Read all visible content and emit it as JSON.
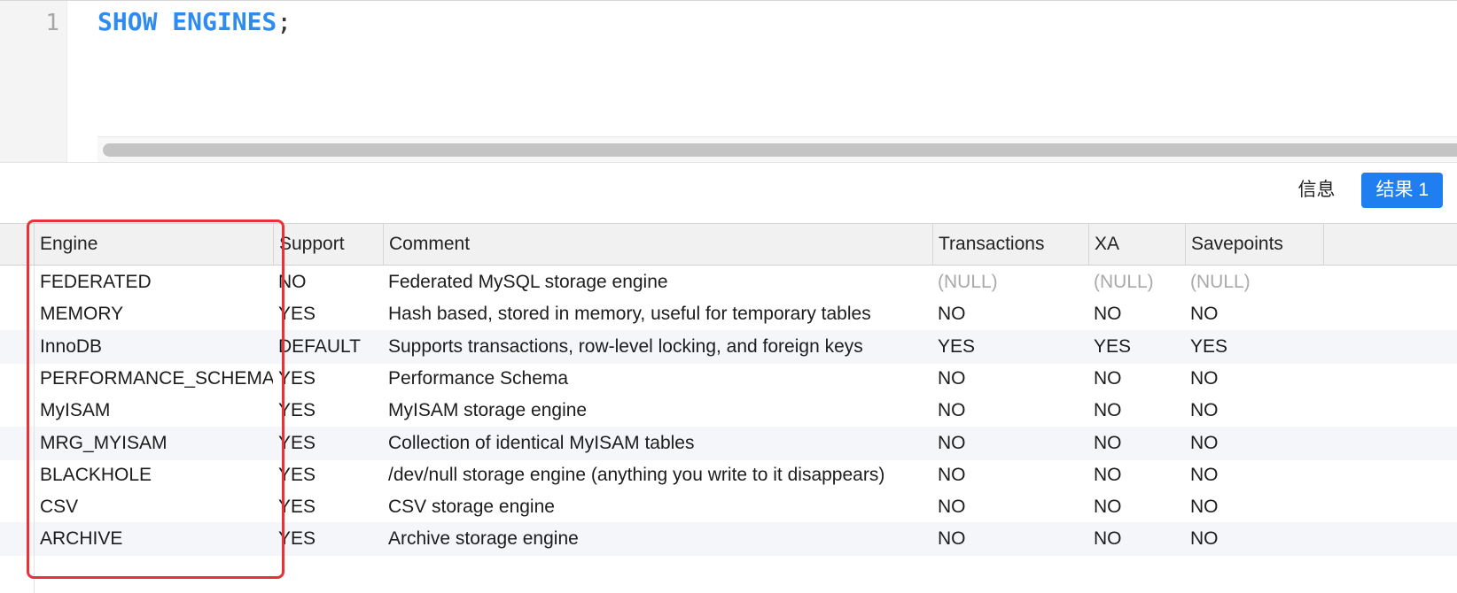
{
  "editor": {
    "line_number": "1",
    "keyword": "SHOW ENGINES",
    "terminator": ";"
  },
  "tabs": {
    "info": "信息",
    "result": "结果 1"
  },
  "table": {
    "columns": [
      "Engine",
      "Support",
      "Comment",
      "Transactions",
      "XA",
      "Savepoints"
    ],
    "rows": [
      [
        "FEDERATED",
        "NO",
        "Federated MySQL storage engine",
        "(NULL)",
        "(NULL)",
        "(NULL)"
      ],
      [
        "MEMORY",
        "YES",
        "Hash based, stored in memory, useful for temporary tables",
        "NO",
        "NO",
        "NO"
      ],
      [
        "InnoDB",
        "DEFAULT",
        "Supports transactions, row-level locking, and foreign keys",
        "YES",
        "YES",
        "YES"
      ],
      [
        "PERFORMANCE_SCHEMA",
        "YES",
        "Performance Schema",
        "NO",
        "NO",
        "NO"
      ],
      [
        "MyISAM",
        "YES",
        "MyISAM storage engine",
        "NO",
        "NO",
        "NO"
      ],
      [
        "MRG_MYISAM",
        "YES",
        "Collection of identical MyISAM tables",
        "NO",
        "NO",
        "NO"
      ],
      [
        "BLACKHOLE",
        "YES",
        "/dev/null storage engine (anything you write to it disappears)",
        "NO",
        "NO",
        "NO"
      ],
      [
        "CSV",
        "YES",
        "CSV storage engine",
        "NO",
        "NO",
        "NO"
      ],
      [
        "ARCHIVE",
        "YES",
        "Archive storage engine",
        "NO",
        "NO",
        "NO"
      ]
    ]
  },
  "colors": {
    "keyword": "#2e8bf0",
    "active_tab": "#1f7ff0",
    "highlight_box": "#e8323a",
    "null_text": "#a9a9a9"
  }
}
